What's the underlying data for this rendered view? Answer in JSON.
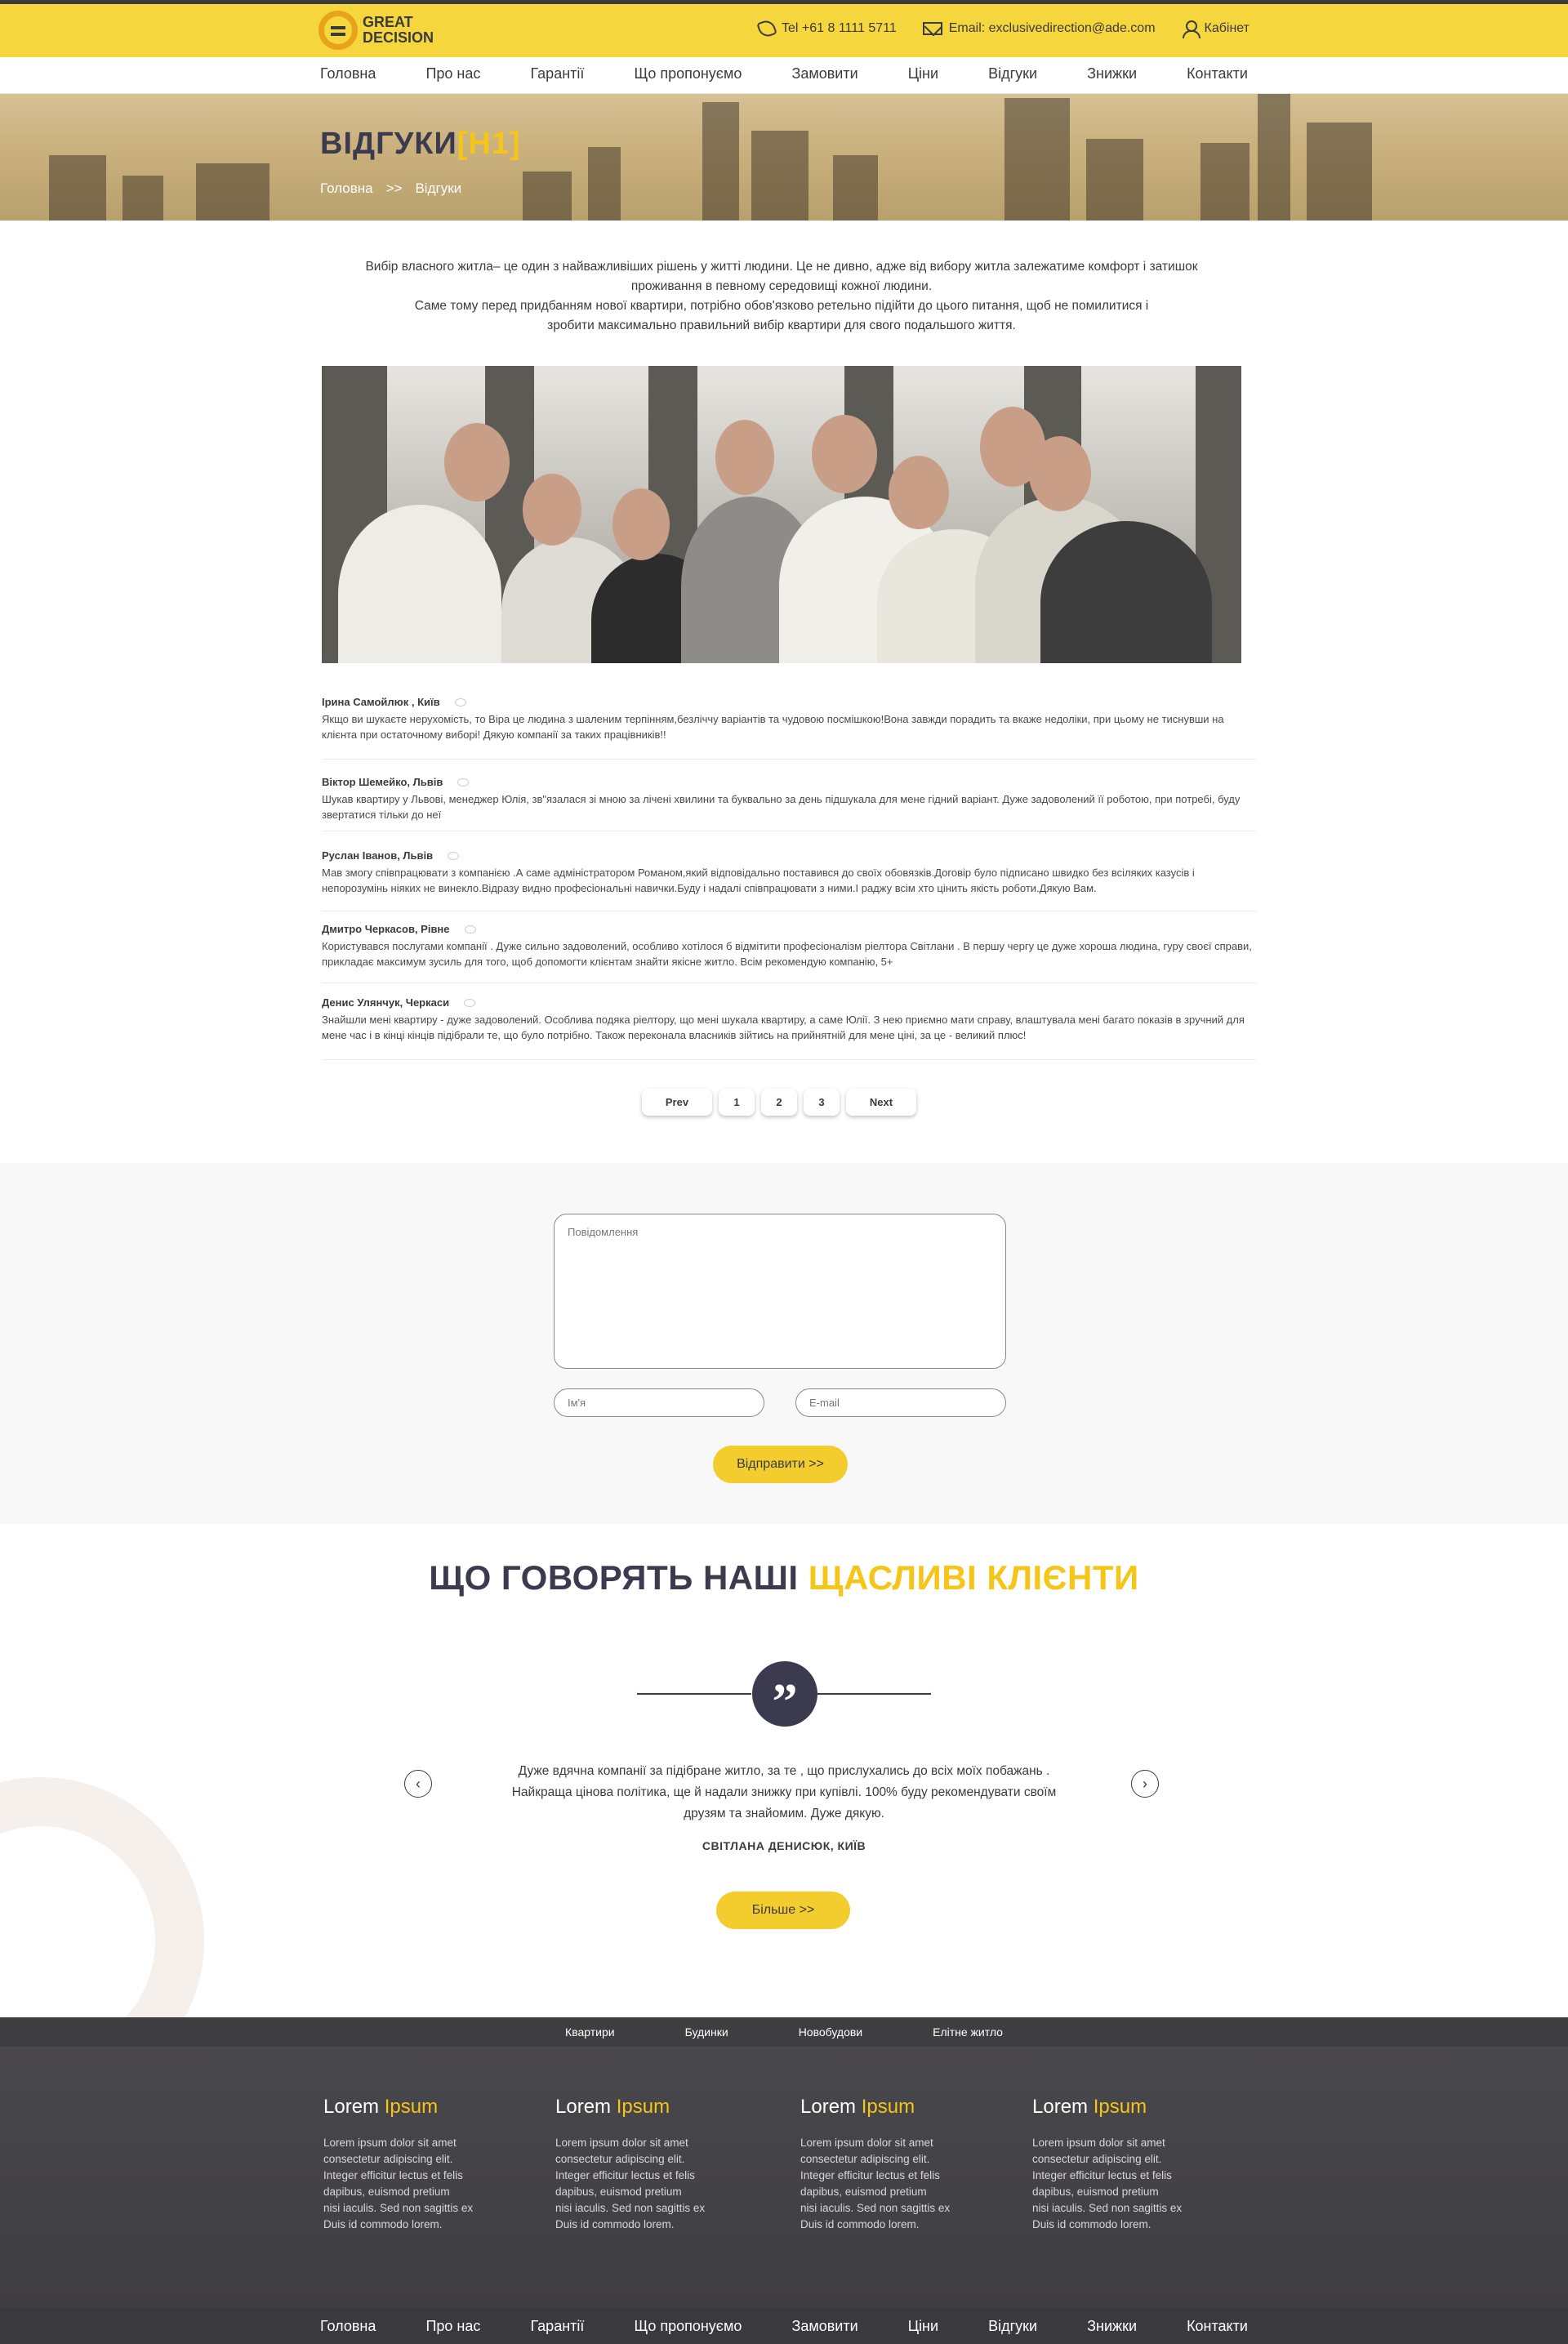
{
  "header": {
    "logo_line1": "GREAT",
    "logo_line2": "DECISION",
    "phone": "Tel +61 8 1111 5711",
    "email": "Email: exclusivedirection@ade.com",
    "cabinet": "Кабінет",
    "colors": {
      "accent": "#f5d63d",
      "dark": "#3b3a3e"
    }
  },
  "nav": [
    "Головна",
    "Про нас",
    "Гарантії",
    "Що пропонуємо",
    "Замовити",
    "Ціни",
    "Відгуки",
    "Знижки",
    "Контакти"
  ],
  "hero": {
    "title": "ВІДГУКИ",
    "title_tag": "[H1]",
    "breadcrumb_home": "Головна",
    "breadcrumb_sep": ">>",
    "breadcrumb_current": "Відгуки"
  },
  "intro": {
    "line1": "Вибір власного житла– це один з найважливіших рішень у житті людини. Це не дивно, адже від вибору житла залежатиме комфорт і затишок",
    "line2": "проживання в певному середовищі кожної людини.",
    "line3": "Саме тому перед придбанням нової квартири, потрібно обов'язково ретельно підійти до цього питання, щоб не помилитися і",
    "line4": "зробити максимально правильний вибір квартири для свого подальшого життя."
  },
  "reviews": [
    {
      "author": "Ірина Самойлюк , Київ",
      "text": "Якщо ви шукаєте нерухомість, то Віра це людина з шаленим терпінням,безліччу варіантів та чудовою посмішкою!Вона завжди порадить та вкаже недоліки, при цьому не тиснувши на клієнта при остаточному виборі! Дякую компанії за таких працівників!!"
    },
    {
      "author": "Віктор Шемейко, Львів",
      "text": "Шукав квартиру у Львові, менеджер Юлія, зв\"язалася зі мною за лічені хвилини та буквально за день підшукала для мене гідний варіант. Дуже задоволений її роботою, при потребі, буду звертатися тільки до неї"
    },
    {
      "author": "Руслан Іванов, Львів",
      "text": "Мав змогу співпрацювати з компанією .А саме адміністратором Романом,який відповідально поставився до своїх обовязків.Договір було підписано швидко без всіляких казусів і непорозумінь ніяких не винекло.Відразу видно професіональні навички.Буду і надалі співпрацювати з ними.І раджу всім хто цінить якість роботи.Дякую Вам."
    },
    {
      "author": "Дмитро Черкасов, Рівне",
      "text": "Користувався послугами компанії . Дуже сильно задоволений, особливо хотілося б відмітити професіоналізм ріелтора Світлани . В першу чергу це дуже хороша людина, гуру своєї справи, прикладає максимум зусиль для того, щоб допомогти клієнтам знайти якісне житло. Всім рекомендую компанію, 5+"
    },
    {
      "author": "Денис Улянчук, Черкаси",
      "text": "Знайшли мені квартиру - дуже задоволений. Особлива подяка ріелтору, що мені шукала квартиру, а саме  Юлії. З нею приємно мати справу, влаштувала мені багато показів в зручний для мене час і в кінці кінців підібрали те, що було потрібно. Також переконала власників зійтись на прийнятній для мене ціні, за це - великий плюс!"
    }
  ],
  "pager": {
    "prev": "Prev",
    "pages": [
      "1",
      "2",
      "3"
    ],
    "next": "Next"
  },
  "form": {
    "message_placeholder": "Повідомлення",
    "name_placeholder": "Ім'я",
    "email_placeholder": "E-mail",
    "submit": "Відправити >>"
  },
  "testimonials": {
    "title_dark": "ЩО ГОВОРЯТЬ НАШІ",
    "title_accent": "ЩАСЛИВІ КЛІЄНТИ",
    "quote_line1": "Дуже вдячна компанії за підібране житло, за те , що прислухались до всіх моїх побажань .",
    "quote_line2": "Найкраща цінова політика, ще й надали  знижку при купівлі. 100% буду рекомендувати своїм",
    "quote_line3": "друзям та знайомим. Дуже дякую.",
    "author": "СВІТЛАНА ДЕНИСЮК, КИЇВ",
    "more": "Більше >>"
  },
  "footer_nav": [
    "Квартири",
    "Будинки",
    "Новобудови",
    "Елітне житло"
  ],
  "footer_cols": [
    {
      "title_white": "Lorem",
      "title_accent": "Ipsum",
      "lines": [
        "Lorem ipsum dolor sit amet",
        "consectetur adipiscing elit.",
        "Integer efficitur lectus et felis",
        "dapibus, euismod pretium",
        "nisi iaculis. Sed non sagittis ex",
        "Duis id commodo lorem."
      ]
    },
    {
      "title_white": "Lorem",
      "title_accent": "Ipsum",
      "lines": [
        "Lorem ipsum dolor sit amet",
        "consectetur adipiscing elit.",
        "Integer efficitur lectus et felis",
        "dapibus, euismod pretium",
        "nisi iaculis. Sed non sagittis ex",
        "Duis id commodo lorem."
      ]
    },
    {
      "title_white": "Lorem",
      "title_accent": "Ipsum",
      "lines": [
        "Lorem ipsum dolor sit amet",
        "consectetur adipiscing elit.",
        "Integer efficitur lectus et felis",
        "dapibus, euismod pretium",
        "nisi iaculis. Sed non sagittis ex",
        "Duis id commodo lorem."
      ]
    },
    {
      "title_white": "Lorem",
      "title_accent": "Ipsum",
      "lines": [
        "Lorem ipsum dolor sit amet",
        "consectetur adipiscing elit.",
        "Integer efficitur lectus et felis",
        "dapibus, euismod pretium",
        "nisi iaculis. Sed non sagittis ex",
        "Duis id commodo lorem."
      ]
    }
  ],
  "bottom_nav": [
    "Головна",
    "Про нас",
    "Гарантії",
    "Що пропонуємо",
    "Замовити",
    "Ціни",
    "Відгуки",
    "Знижки",
    "Контакти"
  ]
}
